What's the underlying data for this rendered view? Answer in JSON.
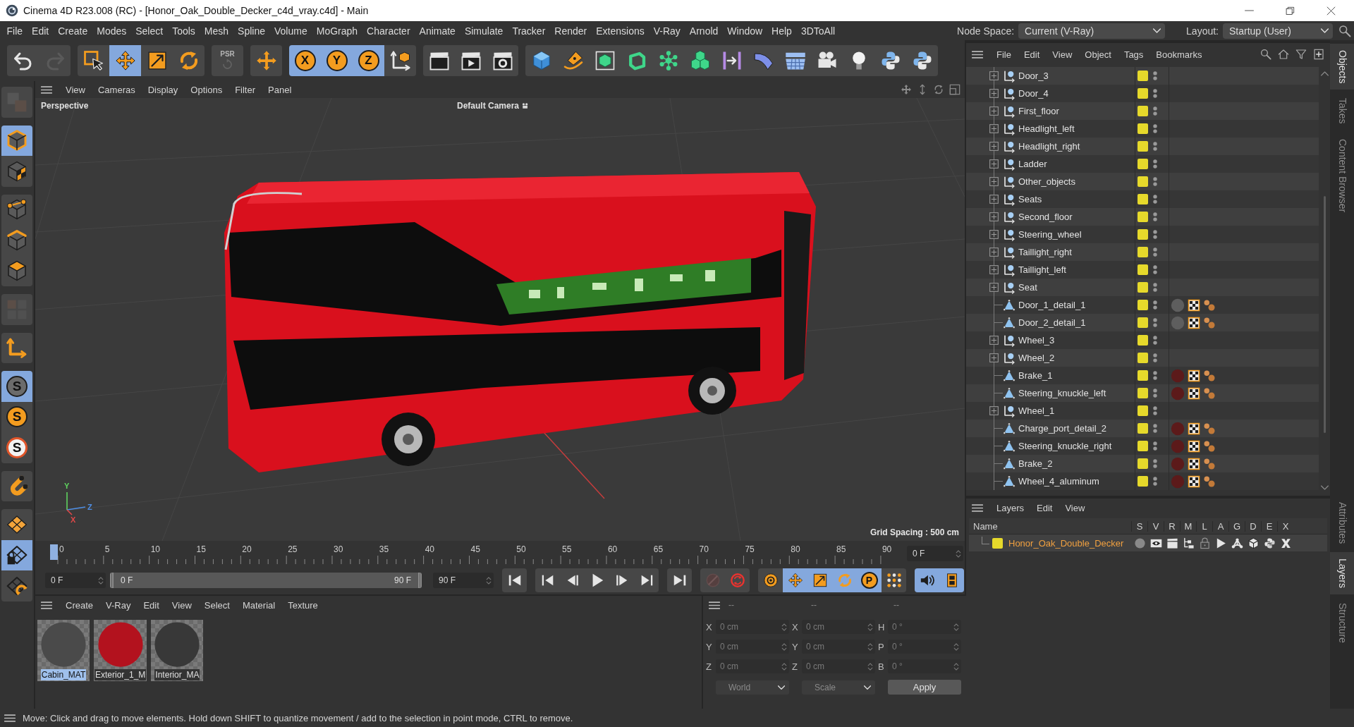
{
  "window": {
    "title": "Cinema 4D R23.008 (RC) - [Honor_Oak_Double_Decker_c4d_vray.c4d] - Main"
  },
  "menu_bar": [
    "File",
    "Edit",
    "Create",
    "Modes",
    "Select",
    "Tools",
    "Mesh",
    "Spline",
    "Volume",
    "MoGraph",
    "Character",
    "Animate",
    "Simulate",
    "Tracker",
    "Render",
    "Extensions",
    "V-Ray",
    "Arnold",
    "Window",
    "Help",
    "3DToAll"
  ],
  "node_space": {
    "label": "Node Space:",
    "value": "Current (V-Ray)"
  },
  "layout": {
    "label": "Layout:",
    "value": "Startup (User)"
  },
  "toolbar": [
    [
      {
        "kind": "undo",
        "selected": false,
        "disabled": false
      },
      {
        "kind": "redo",
        "selected": false,
        "disabled": true
      }
    ],
    [
      {
        "kind": "select",
        "selected": false,
        "disabled": false
      },
      {
        "kind": "move",
        "selected": true,
        "disabled": false
      },
      {
        "kind": "scale",
        "selected": false,
        "disabled": false
      },
      {
        "kind": "rotate",
        "selected": false,
        "disabled": false
      }
    ],
    [
      {
        "kind": "psr",
        "label": "PSR",
        "selected": false,
        "disabled": true
      }
    ],
    [
      {
        "kind": "transfer",
        "selected": false,
        "disabled": false
      }
    ],
    [
      {
        "kind": "axis-lock",
        "label": "X",
        "selected": true,
        "disabled": false
      },
      {
        "kind": "axis-lock",
        "label": "Y",
        "selected": true,
        "disabled": false
      },
      {
        "kind": "axis-lock",
        "label": "Z",
        "selected": true,
        "disabled": false
      },
      {
        "kind": "coords",
        "selected": false,
        "disabled": false
      }
    ],
    [
      {
        "kind": "render-view",
        "selected": false,
        "disabled": false
      },
      {
        "kind": "render",
        "selected": false,
        "disabled": false
      },
      {
        "kind": "render-settings",
        "selected": false,
        "disabled": false
      }
    ],
    [
      {
        "kind": "cube",
        "selected": false,
        "disabled": false
      },
      {
        "kind": "pen",
        "selected": false,
        "disabled": false
      },
      {
        "kind": "subdivision",
        "selected": false,
        "disabled": false
      },
      {
        "kind": "extrude",
        "selected": false,
        "disabled": false
      },
      {
        "kind": "cloner",
        "selected": false,
        "disabled": false
      },
      {
        "kind": "fracture",
        "selected": false,
        "disabled": false
      },
      {
        "kind": "deformer",
        "selected": false,
        "disabled": false
      },
      {
        "kind": "bend",
        "selected": false,
        "disabled": false
      },
      {
        "kind": "floor",
        "selected": false,
        "disabled": false
      },
      {
        "kind": "camera",
        "selected": false,
        "disabled": false
      },
      {
        "kind": "light",
        "selected": false,
        "disabled": false
      },
      {
        "kind": "script",
        "selected": false,
        "disabled": false
      },
      {
        "kind": "script",
        "selected": false,
        "disabled": false
      }
    ]
  ],
  "tools": [
    [
      {
        "kind": "make-editable",
        "selected": false,
        "disabled": true
      }
    ],
    [
      {
        "kind": "model",
        "selected": true,
        "disabled": false
      },
      {
        "kind": "texture",
        "selected": false,
        "disabled": false
      }
    ],
    [
      {
        "kind": "points",
        "selected": false,
        "disabled": false
      },
      {
        "kind": "edges",
        "selected": false,
        "disabled": false
      },
      {
        "kind": "polygons",
        "selected": false,
        "disabled": false
      }
    ],
    [
      {
        "kind": "uv",
        "selected": false,
        "disabled": true
      }
    ],
    [
      {
        "kind": "axis",
        "selected": false,
        "disabled": false
      }
    ],
    [
      {
        "kind": "snap",
        "label": "S",
        "selected": true,
        "disabled": false
      },
      {
        "kind": "snap-3d",
        "label": "S",
        "selected": false,
        "disabled": false
      },
      {
        "kind": "snap-quantize",
        "label": "S",
        "selected": false,
        "disabled": false
      }
    ],
    [
      {
        "kind": "magnet",
        "selected": false,
        "disabled": false
      }
    ],
    [
      {
        "kind": "workplane",
        "selected": false,
        "disabled": false
      },
      {
        "kind": "workplane-lock",
        "selected": true,
        "disabled": false
      },
      {
        "kind": "workplane-align",
        "selected": false,
        "disabled": false
      }
    ]
  ],
  "viewport": {
    "menu": [
      "View",
      "Cameras",
      "Display",
      "Options",
      "Filter",
      "Panel"
    ],
    "view_name": "Perspective",
    "camera": "Default Camera",
    "grid_spacing": "Grid Spacing : 500 cm",
    "axis_labels": [
      "Y",
      "Z",
      "X"
    ]
  },
  "timeline": {
    "ticks": [
      "0",
      "5",
      "10",
      "15",
      "20",
      "25",
      "30",
      "35",
      "40",
      "45",
      "50",
      "55",
      "60",
      "65",
      "70",
      "75",
      "80",
      "85",
      "90"
    ],
    "playhead": {
      "level": 0
    },
    "frame": "0 F"
  },
  "playback": {
    "start": "0 F",
    "range": {
      "start": "0 F",
      "end": "90 F"
    },
    "end": "90 F",
    "buttons": [
      [
        {
          "kind": "go-start",
          "selected": false,
          "disabled": false
        }
      ],
      [
        {
          "kind": "prev-key",
          "selected": false,
          "disabled": false
        },
        {
          "kind": "prev-frame",
          "selected": false,
          "disabled": false
        },
        {
          "kind": "play",
          "selected": false,
          "disabled": false
        },
        {
          "kind": "next-frame",
          "selected": false,
          "disabled": false
        },
        {
          "kind": "next-key",
          "selected": false,
          "disabled": false
        }
      ],
      [
        {
          "kind": "go-end",
          "selected": false,
          "disabled": false
        }
      ],
      [
        {
          "kind": "autokey",
          "selected": false,
          "disabled": true
        },
        {
          "kind": "record",
          "selected": false,
          "disabled": false
        }
      ],
      [
        {
          "kind": "key-settings",
          "selected": false,
          "disabled": false
        },
        {
          "kind": "key-position",
          "selected": true,
          "disabled": false
        },
        {
          "kind": "key-scale",
          "selected": true,
          "disabled": false
        },
        {
          "kind": "key-rotation",
          "selected": true,
          "disabled": false
        },
        {
          "kind": "key-param",
          "label": "P",
          "selected": true,
          "disabled": false
        },
        {
          "kind": "key-pla",
          "selected": false,
          "disabled": false
        }
      ],
      [
        {
          "kind": "sound",
          "selected": true,
          "disabled": false
        },
        {
          "kind": "film",
          "selected": true,
          "disabled": false
        }
      ]
    ]
  },
  "materials": {
    "menu": [
      "Create",
      "V-Ray",
      "Edit",
      "View",
      "Select",
      "Material",
      "Texture"
    ],
    "items": [
      {
        "name": "Cabin_MAT",
        "color": "#4a4a4a",
        "selected": true
      },
      {
        "name": "Exterior_1_M",
        "color": "#b3121e",
        "selected": false
      },
      {
        "name": "Interior_MA",
        "color": "#383838",
        "selected": false
      }
    ]
  },
  "coordinates": {
    "disabled": true,
    "headers": [
      "--",
      "--",
      "--"
    ],
    "rows": [
      [
        {
          "label": "X",
          "value": "0 cm"
        },
        {
          "label": "X",
          "value": "0 cm"
        },
        {
          "label": "H",
          "value": "0 °"
        }
      ],
      [
        {
          "label": "Y",
          "value": "0 cm"
        },
        {
          "label": "Y",
          "value": "0 cm"
        },
        {
          "label": "P",
          "value": "0 °"
        }
      ],
      [
        {
          "label": "Z",
          "value": "0 cm"
        },
        {
          "label": "Z",
          "value": "0 cm"
        },
        {
          "label": "B",
          "value": "0 °"
        }
      ]
    ],
    "mode": "World",
    "size_mode": "Scale",
    "apply": "Apply"
  },
  "objects": {
    "menu": [
      "File",
      "Edit",
      "View",
      "Object",
      "Tags",
      "Bookmarks"
    ],
    "rows": [
      {
        "name": "Door_3",
        "kind": "null",
        "expanded": false,
        "selected": false,
        "color": "#e6d92b"
      },
      {
        "name": "Door_4",
        "kind": "null",
        "expanded": false,
        "selected": false,
        "color": "#e6d92b"
      },
      {
        "name": "First_floor",
        "kind": "null",
        "expanded": false,
        "selected": false,
        "color": "#e6d92b"
      },
      {
        "name": "Headlight_left",
        "kind": "null",
        "expanded": false,
        "selected": false,
        "color": "#e6d92b"
      },
      {
        "name": "Headlight_right",
        "kind": "null",
        "expanded": false,
        "selected": false,
        "color": "#e6d92b"
      },
      {
        "name": "Ladder",
        "kind": "null",
        "expanded": false,
        "selected": false,
        "color": "#e6d92b"
      },
      {
        "name": "Other_objects",
        "kind": "null",
        "expanded": false,
        "selected": false,
        "color": "#e6d92b"
      },
      {
        "name": "Seats",
        "kind": "null",
        "expanded": false,
        "selected": false,
        "color": "#e6d92b"
      },
      {
        "name": "Second_floor",
        "kind": "null",
        "expanded": false,
        "selected": false,
        "color": "#e6d92b"
      },
      {
        "name": "Steering_wheel",
        "kind": "null",
        "expanded": false,
        "selected": false,
        "color": "#e6d92b"
      },
      {
        "name": "Taillight_right",
        "kind": "null",
        "expanded": false,
        "selected": false,
        "color": "#e6d92b"
      },
      {
        "name": "Taillight_left",
        "kind": "null",
        "expanded": false,
        "selected": false,
        "color": "#e6d92b"
      },
      {
        "name": "Seat",
        "kind": "null",
        "expanded": false,
        "selected": false,
        "color": "#e6d92b"
      },
      {
        "name": "Door_1_detail_1",
        "kind": "polygon",
        "selected": false,
        "color": "#e6d92b",
        "tags": [
          {
            "kind": "material",
            "color": "#5e5e5e"
          },
          {
            "kind": "uvw"
          },
          {
            "kind": "phong"
          }
        ]
      },
      {
        "name": "Door_2_detail_1",
        "kind": "polygon",
        "selected": false,
        "color": "#e6d92b",
        "tags": [
          {
            "kind": "material",
            "color": "#5e5e5e"
          },
          {
            "kind": "uvw"
          },
          {
            "kind": "phong"
          }
        ]
      },
      {
        "name": "Wheel_3",
        "kind": "null",
        "expanded": false,
        "selected": false,
        "color": "#e6d92b"
      },
      {
        "name": "Wheel_2",
        "kind": "null",
        "expanded": false,
        "selected": false,
        "color": "#e6d92b"
      },
      {
        "name": "Brake_1",
        "kind": "polygon",
        "selected": false,
        "color": "#e6d92b",
        "tags": [
          {
            "kind": "material",
            "color": "#5c1a1a"
          },
          {
            "kind": "uvw"
          },
          {
            "kind": "phong"
          }
        ]
      },
      {
        "name": "Steering_knuckle_left",
        "kind": "polygon",
        "selected": false,
        "color": "#e6d92b",
        "tags": [
          {
            "kind": "material",
            "color": "#5c1a1a"
          },
          {
            "kind": "uvw"
          },
          {
            "kind": "phong"
          }
        ]
      },
      {
        "name": "Wheel_1",
        "kind": "null",
        "expanded": false,
        "selected": false,
        "color": "#e6d92b"
      },
      {
        "name": "Charge_port_detail_2",
        "kind": "polygon",
        "selected": false,
        "color": "#e6d92b",
        "tags": [
          {
            "kind": "material",
            "color": "#5c1a1a"
          },
          {
            "kind": "uvw"
          },
          {
            "kind": "phong"
          }
        ]
      },
      {
        "name": "Steering_knuckle_right",
        "kind": "polygon",
        "selected": false,
        "color": "#e6d92b",
        "tags": [
          {
            "kind": "material",
            "color": "#5c1a1a"
          },
          {
            "kind": "uvw"
          },
          {
            "kind": "phong"
          }
        ]
      },
      {
        "name": "Brake_2",
        "kind": "polygon",
        "selected": false,
        "color": "#e6d92b",
        "tags": [
          {
            "kind": "material",
            "color": "#5c1a1a"
          },
          {
            "kind": "uvw"
          },
          {
            "kind": "phong"
          }
        ]
      },
      {
        "name": "Wheel_4_aluminum",
        "kind": "polygon",
        "selected": false,
        "color": "#e6d92b",
        "tags": [
          {
            "kind": "material",
            "color": "#5c1a1a"
          },
          {
            "kind": "uvw"
          },
          {
            "kind": "phong"
          }
        ]
      }
    ]
  },
  "layers": {
    "menu": [
      "Layers",
      "Edit",
      "View"
    ],
    "columns": [
      "Name",
      "S",
      "V",
      "R",
      "M",
      "L",
      "A",
      "G",
      "D",
      "E",
      "X"
    ],
    "rows": [
      {
        "name": "Honor_Oak_Double_Decker",
        "color": "#e6d92b",
        "flags": [
          {
            "kind": "solo",
            "on": false
          },
          {
            "kind": "view",
            "on": true
          },
          {
            "kind": "render",
            "on": true
          },
          {
            "kind": "manager",
            "on": true
          },
          {
            "kind": "lock",
            "on": false
          },
          {
            "kind": "animation",
            "on": true
          },
          {
            "kind": "generators",
            "on": true
          },
          {
            "kind": "deformers",
            "on": true
          },
          {
            "kind": "expressions",
            "on": true
          },
          {
            "kind": "xrefs",
            "on": true
          }
        ]
      }
    ]
  },
  "side_tabs": {
    "top": [
      {
        "label": "Objects",
        "selected": true
      },
      {
        "label": "Takes",
        "selected": false
      },
      {
        "label": "Content Browser",
        "selected": false
      }
    ],
    "bottom": [
      {
        "label": "Attributes",
        "selected": false
      },
      {
        "label": "Layers",
        "selected": true
      },
      {
        "label": "Structure",
        "selected": false
      }
    ]
  },
  "status_bar": "Move: Click and drag to move elements. Hold down SHIFT to quantize movement / add to the selection in point mode, CTRL to remove."
}
